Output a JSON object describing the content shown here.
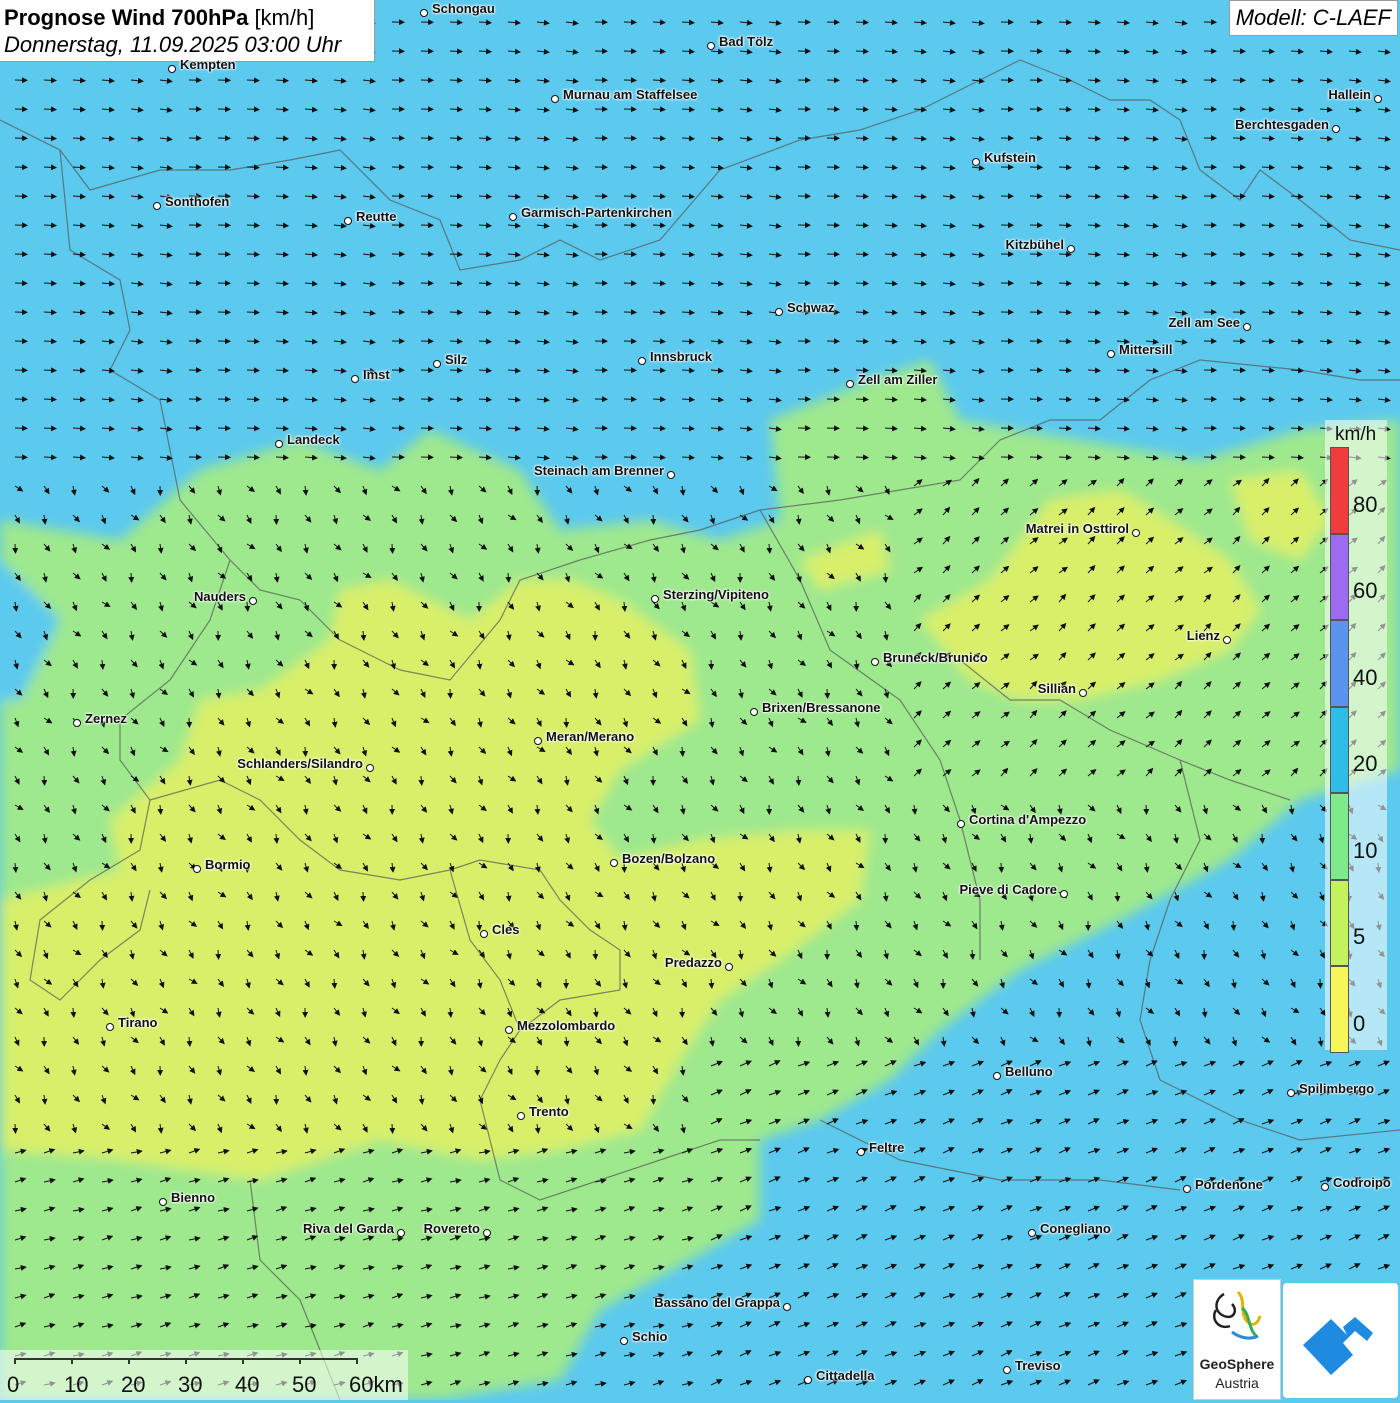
{
  "header": {
    "title_bold": "Prognose Wind 700hPa",
    "title_unit": "[km/h]",
    "datetime": "Donnerstag, 11.09.2025 03:00 Uhr"
  },
  "model": {
    "label": "Modell: C-LAEF"
  },
  "cities": [
    {
      "name": "Schongau"
    },
    {
      "name": "Bad Tölz"
    },
    {
      "name": "Kempten"
    },
    {
      "name": "Murnau am Staffelsee"
    },
    {
      "name": "Hallein"
    },
    {
      "name": "Berchtesgaden"
    },
    {
      "name": "Kufstein"
    },
    {
      "name": "Sonthofen"
    },
    {
      "name": "Reutte"
    },
    {
      "name": "Garmisch-Partenkirchen"
    },
    {
      "name": "Kitzbühel"
    },
    {
      "name": "Schwaz"
    },
    {
      "name": "Zell am See"
    },
    {
      "name": "Mittersill"
    },
    {
      "name": "Innsbruck"
    },
    {
      "name": "Silz"
    },
    {
      "name": "Imst"
    },
    {
      "name": "Zell am Ziller"
    },
    {
      "name": "Landeck"
    },
    {
      "name": "Steinach am Brenner"
    },
    {
      "name": "Matrei in Osttirol"
    },
    {
      "name": "Nauders"
    },
    {
      "name": "Sterzing/Vipiteno"
    },
    {
      "name": "Lienz"
    },
    {
      "name": "Bruneck/Brunico"
    },
    {
      "name": "Sillian"
    },
    {
      "name": "Zernez"
    },
    {
      "name": "Brixen/Bressanone"
    },
    {
      "name": "Meran/Merano"
    },
    {
      "name": "Schlanders/Silandro"
    },
    {
      "name": "Cortina d'Ampezzo"
    },
    {
      "name": "Bozen/Bolzano"
    },
    {
      "name": "Bormio"
    },
    {
      "name": "Pieve di Cadore"
    },
    {
      "name": "Cles"
    },
    {
      "name": "Predazzo"
    },
    {
      "name": "Tirano"
    },
    {
      "name": "Mezzolombardo"
    },
    {
      "name": "Belluno"
    },
    {
      "name": "Spilimbergo"
    },
    {
      "name": "Trento"
    },
    {
      "name": "Feltre"
    },
    {
      "name": "Pordenone"
    },
    {
      "name": "Codroipo"
    },
    {
      "name": "Bienno"
    },
    {
      "name": "Riva del Garda"
    },
    {
      "name": "Rovereto"
    },
    {
      "name": "Conegliano"
    },
    {
      "name": "Bassano del Grappa"
    },
    {
      "name": "Schio"
    },
    {
      "name": "Treviso"
    },
    {
      "name": "Cittadella"
    }
  ],
  "legend": {
    "unit": "km/h",
    "ticks": [
      "80",
      "60",
      "40",
      "20",
      "10",
      "5",
      "0"
    ],
    "colors": [
      "#f03c3c",
      "#9b6cf0",
      "#5a94ee",
      "#2fbde8",
      "#7eea8c",
      "#c4f25a",
      "#f6f65a"
    ]
  },
  "scalebar": {
    "labels": [
      "0",
      "10",
      "20",
      "30",
      "40",
      "50",
      "60km"
    ]
  },
  "logo": {
    "line1": "GeoSphere",
    "line2": "Austria"
  },
  "field_colors": {
    "fast": "#5cc9ee",
    "mid": "#9ee88e",
    "slow": "#d9ef6a"
  }
}
